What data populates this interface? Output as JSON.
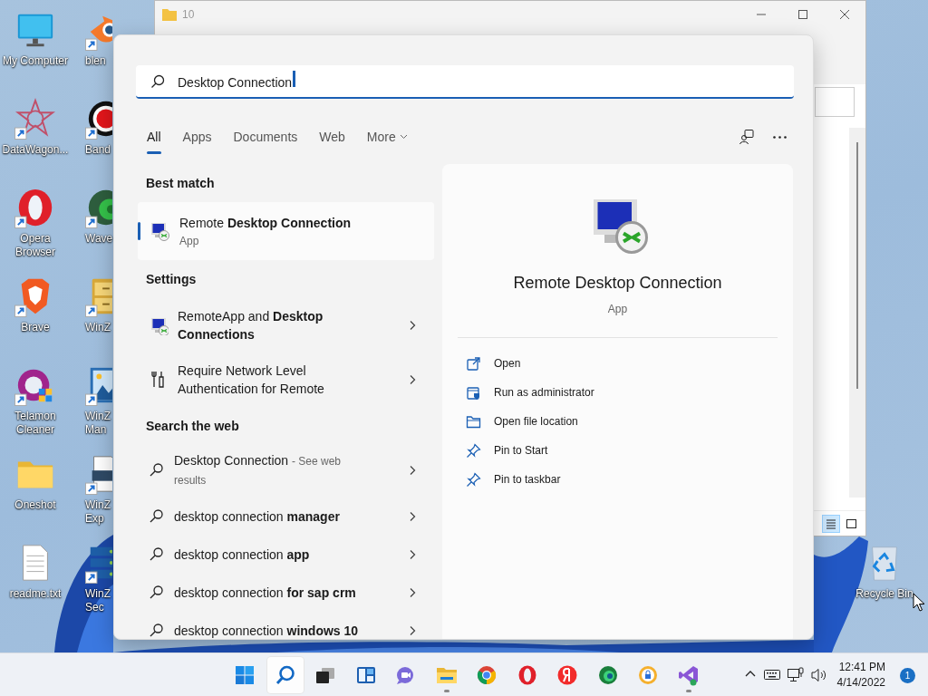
{
  "desktop_icons": [
    {
      "label": "My Computer",
      "shortcut": false
    },
    {
      "label": "DataWagon...",
      "shortcut": true
    },
    {
      "label": "Opera Browser",
      "shortcut": true
    },
    {
      "label": "Brave",
      "shortcut": true
    },
    {
      "label": "Telamon Cleaner",
      "shortcut": true
    },
    {
      "label": "Oneshot",
      "shortcut": false
    },
    {
      "label": "readme.txt",
      "shortcut": false
    },
    {
      "label": "blen",
      "shortcut": true
    },
    {
      "label": "Band",
      "shortcut": true
    },
    {
      "label": "Wave",
      "shortcut": true
    },
    {
      "label": "WinZ",
      "shortcut": true
    },
    {
      "label": "WinZ\nMan",
      "shortcut": true
    },
    {
      "label": "WinZ\nExp",
      "shortcut": true
    },
    {
      "label": "WinZ\nSec",
      "shortcut": true
    }
  ],
  "recycle_bin": {
    "label": "Recycle Bin"
  },
  "explorer_window": {
    "title": "10",
    "view_buttons": [
      {
        "selected": true
      },
      {
        "selected": false
      }
    ]
  },
  "search_panel": {
    "query": "Desktop Connection",
    "tabs": [
      {
        "label": "All",
        "selected": true
      },
      {
        "label": "Apps",
        "selected": false
      },
      {
        "label": "Documents",
        "selected": false
      },
      {
        "label": "Web",
        "selected": false
      },
      {
        "label": "More",
        "selected": false
      }
    ],
    "best_match": {
      "heading": "Best match",
      "title": "Remote **Desktop Connection**",
      "subtitle": "App",
      "selected": true
    },
    "settings": {
      "heading": "Settings",
      "items": [
        {
          "title": "RemoteApp and **Desktop Connections**"
        },
        {
          "title": "Require Network Level Authentication for Remote"
        }
      ]
    },
    "web": {
      "heading": "Search the web",
      "items": [
        {
          "title": "Desktop Connection",
          "note": "- See web results"
        },
        {
          "title": "desktop connection **manager**"
        },
        {
          "title": "desktop connection **app**"
        },
        {
          "title": "desktop connection **for sap crm**"
        },
        {
          "title": "desktop connection **windows 10**"
        }
      ]
    },
    "detail": {
      "title": "Remote Desktop Connection",
      "subtitle": "App",
      "actions": [
        "Open",
        "Run as administrator",
        "Open file location",
        "Pin to Start",
        "Pin to taskbar"
      ]
    }
  },
  "taskbar": {
    "apps": [
      {
        "selected": false,
        "running": false
      },
      {
        "selected": true,
        "running": false
      },
      {
        "selected": false,
        "running": false
      },
      {
        "selected": false,
        "running": false
      },
      {
        "selected": false,
        "running": false
      },
      {
        "selected": false,
        "running": true
      },
      {
        "selected": false,
        "running": false
      },
      {
        "selected": false,
        "running": false
      },
      {
        "selected": false,
        "running": false
      },
      {
        "selected": false,
        "running": false
      },
      {
        "selected": false,
        "running": false
      },
      {
        "selected": false,
        "running": true
      }
    ],
    "time": "12:41 PM",
    "date": "4/14/2022",
    "notifications": "1"
  }
}
